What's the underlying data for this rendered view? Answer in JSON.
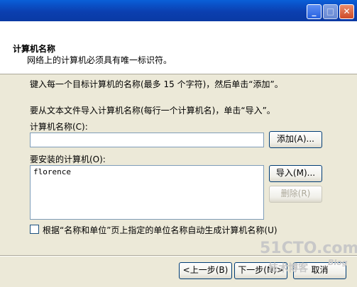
{
  "window": {
    "controls": [
      "minimize-icon",
      "maximize-icon",
      "close-icon"
    ]
  },
  "header": {
    "title": "计算机名称",
    "subtitle": "网络上的计算机必须具有唯一标识符。"
  },
  "body": {
    "instruction1": "键入每一个目标计算机的名称(最多 15 个字符)，然后单击“添加”。",
    "instruction2": "要从文本文件导入计算机名称(每行一个计算机名)，单击“导入”。",
    "name_label": "计算机名称(C):",
    "name_value": "",
    "add_button": "添加(A)...",
    "list_label": "要安装的计算机(O):",
    "computers": [
      "florence"
    ],
    "import_button": "导入(M)...",
    "delete_button": "删除(R)",
    "checkbox_label": "根据“名称和单位”页上指定的单位名称自动生成计算机名称(U)",
    "checkbox_checked": false
  },
  "footer": {
    "back_button": "<上一步(B)",
    "next_button": "下一步(N)>",
    "cancel_button": "取消"
  },
  "watermark": {
    "site": "51CTO.com",
    "sub": "技术博客",
    "blog": "Blog"
  }
}
